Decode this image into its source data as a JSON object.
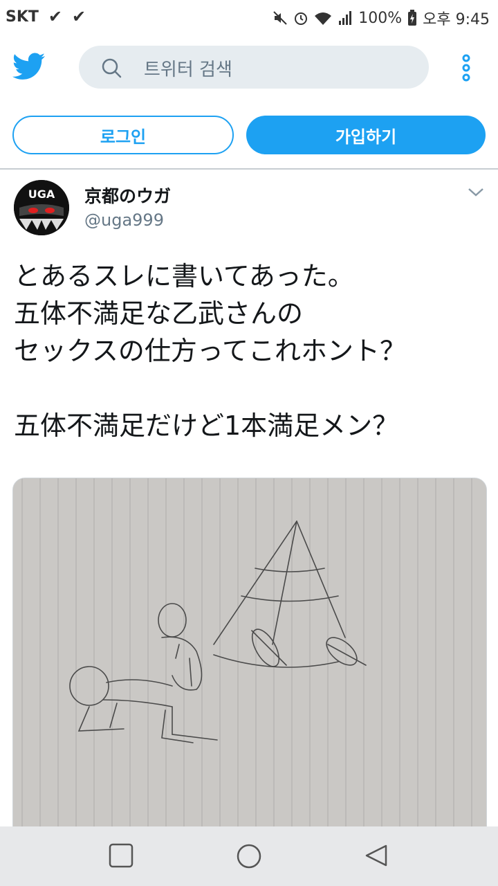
{
  "status_bar": {
    "carrier": "SKT",
    "battery": "100%",
    "time": "오후 9:45"
  },
  "header": {
    "search_placeholder": "트위터 검색",
    "icons": [
      "twitter-bird-icon",
      "search-icon",
      "more-vertical-icon"
    ],
    "accent": "#1da1f2"
  },
  "auth": {
    "login_label": "로그인",
    "signup_label": "가입하기"
  },
  "tweet": {
    "avatar_text": "UGA",
    "display_name": "京都のウガ",
    "handle": "@uga999",
    "text_lines": [
      "とあるスレに書いてあった。",
      "五体不満足な乙武さんの",
      "セックスの仕方ってこれホント？",
      "",
      "五体不満足だけど1本満足メン？"
    ]
  },
  "navbar": {
    "icons": [
      "recent-apps-icon",
      "home-icon",
      "back-icon"
    ]
  }
}
